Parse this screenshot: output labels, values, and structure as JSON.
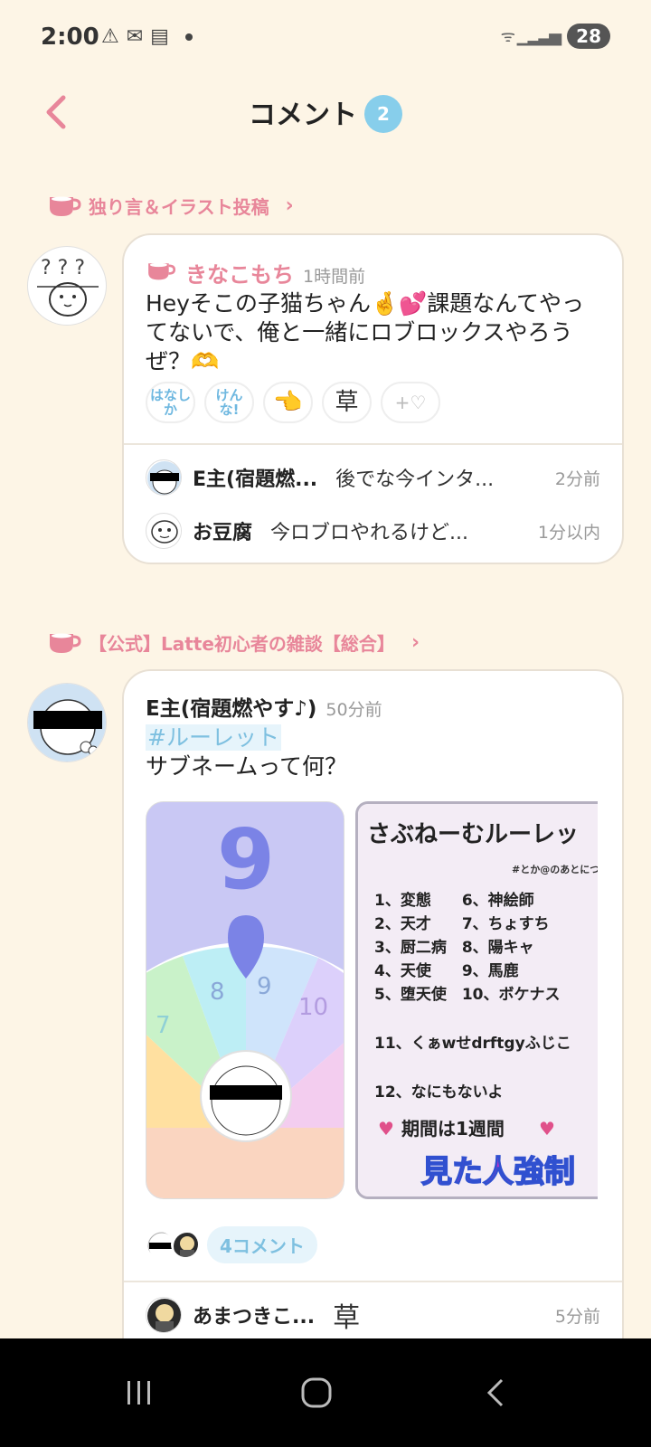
{
  "status_bar": {
    "time": "2:00",
    "icons": [
      "warning-icon",
      "mail-icon",
      "news-icon"
    ],
    "battery": "28"
  },
  "header": {
    "title": "コメント",
    "count": "2"
  },
  "section1": {
    "community": "独り言＆イラスト投稿",
    "post": {
      "author": "きなこもち",
      "time": "1時間前",
      "text": "Heyそこの子猫ちゃん🤞💕課題なんてやってないで、俺と一緒にロブロックスやろうぜ？🫶",
      "reactions": [
        "はなしか",
        "けんな!",
        "👈",
        "草",
        "+♡"
      ],
      "replies": [
        {
          "name": "E主(宿題燃...",
          "text": "後でな今インタ...",
          "time": "2分前"
        },
        {
          "name": "お豆腐",
          "text": "今ロブロやれるけど...",
          "time": "1分以内"
        }
      ]
    }
  },
  "section2": {
    "community": "【公式】Latte初心者の雑談【総合】",
    "post": {
      "author": "E主(宿題燃やす♪)",
      "time": "50分前",
      "hashtag": "#ルーレット",
      "text": "サブネームって何？",
      "roulette_number": "9",
      "wheel_numbers": [
        "7",
        "8",
        "9",
        "10"
      ],
      "rules_title": "さぶねーむルーレッ",
      "rules_sub": "#とか@のあとにつ",
      "rules": [
        "1、変態　　6、神絵師",
        "2、天才　　7、ちょすち",
        "3、厨二病　8、陽キャ",
        "4、天使　　9、馬鹿",
        "5、堕天使　10、ボケナス",
        "11、くぁwせdrftgyふじこ",
        "12、なにもないよ"
      ],
      "rules_period": "期間は1週間",
      "rules_footer": "見た人強制",
      "comment_count": "4コメント",
      "reply": {
        "name": "あまつきこ...",
        "text": "草",
        "time": "5分前"
      }
    }
  }
}
